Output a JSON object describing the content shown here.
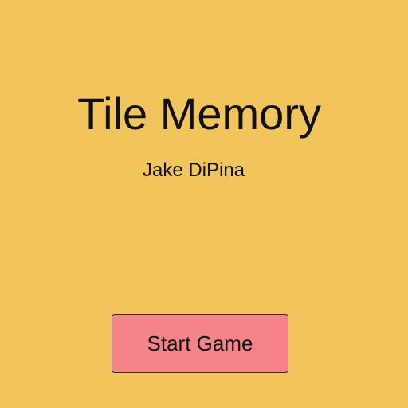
{
  "colors": {
    "background": "#f2c45c",
    "button_background": "#f6838a",
    "text": "#111111"
  },
  "title_screen": {
    "title": "Tile Memory",
    "author": "Jake DiPina",
    "start_button_label": "Start Game"
  }
}
